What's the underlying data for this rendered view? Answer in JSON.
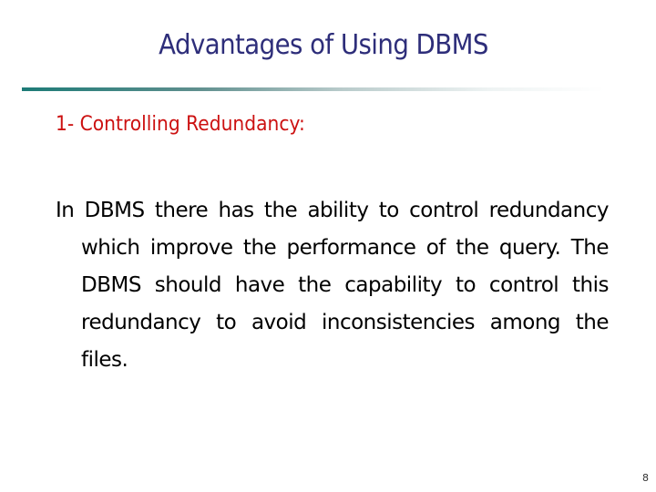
{
  "slide": {
    "title": "Advantages of Using DBMS",
    "subtitle": "1- Controlling Redundancy:",
    "body": "In DBMS there has the ability to control redundancy which improve the  performance of the query. The DBMS should have the capability to control this redundancy to avoid inconsistencies among the files.",
    "page_number": "8",
    "colors": {
      "title": "#2e2e7a",
      "subtitle": "#cc1111",
      "rule_start": "#1d7b77",
      "body": "#000000"
    }
  }
}
